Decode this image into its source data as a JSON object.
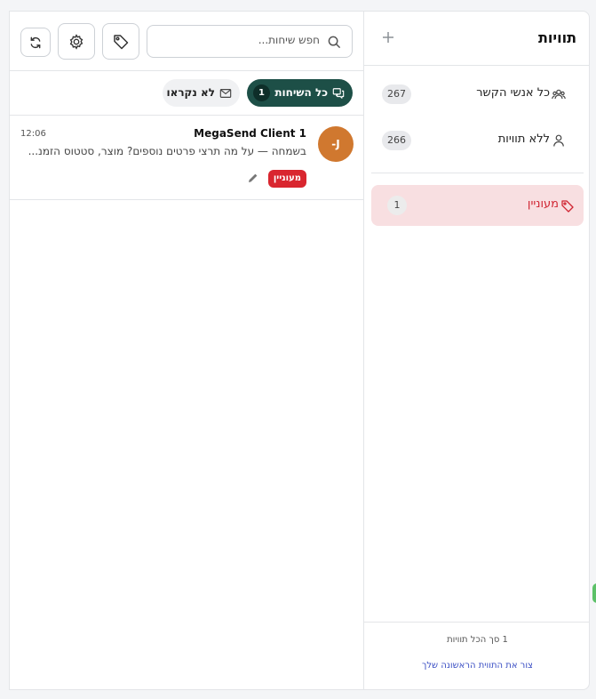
{
  "sidebar": {
    "title": "תוויות",
    "add_icon": "plus-icon",
    "items": [
      {
        "label": "כל אנשי הקשר",
        "count": "267",
        "icon": "users-icon"
      },
      {
        "label": "ללא תוויות",
        "count": "266",
        "icon": "user-icon"
      }
    ],
    "labels": [
      {
        "label": "מעוניין",
        "count": "1",
        "icon": "tag-icon",
        "color": "#d02532"
      }
    ],
    "footer": {
      "summary": "1 סך הכל תוויות",
      "create_link": "צור את התווית הראשונה שלך"
    }
  },
  "toolbar": {
    "search_placeholder": "חפש שיחות...",
    "buttons": [
      "tag-icon",
      "gear-icon",
      "refresh-icon"
    ]
  },
  "tabs": {
    "all_label": "כל השיחות",
    "all_count": "1",
    "unread_label": "לא נקראו"
  },
  "conversations": [
    {
      "avatar": "-J",
      "name": "MegaSend Client 1",
      "time": "12:06",
      "preview": "בשמחה — על מה תרצי פרטים נוספים? מוצר, סטטוס הזמנ...",
      "tag": "מעוניין"
    }
  ],
  "colors": {
    "accent": "#1d4f47",
    "tag_red": "#d9262f",
    "avatar": "#d0782f",
    "active_label_bg": "#f8dfe1"
  }
}
